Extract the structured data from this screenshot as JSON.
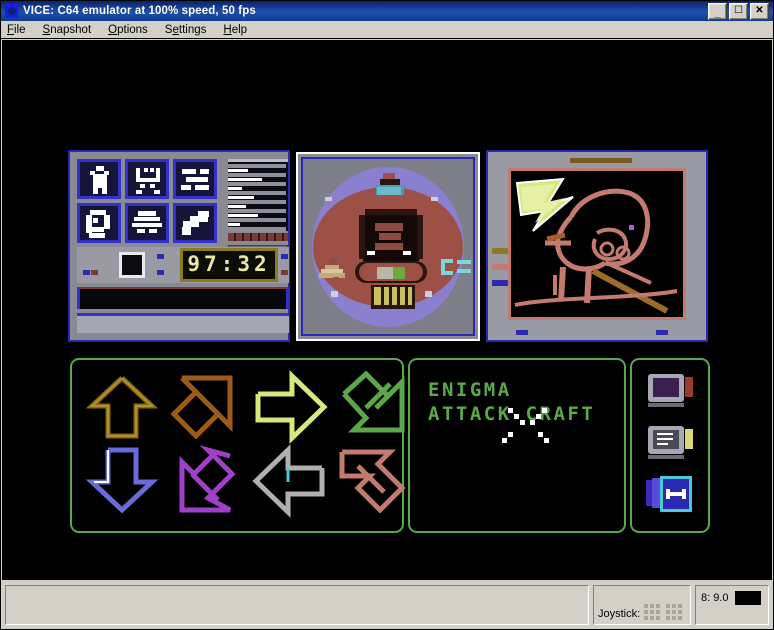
{
  "window": {
    "title": "VICE: C64 emulator at 100% speed, 50 fps",
    "icon": "vice-c64-icon",
    "buttons": {
      "minimize": "_",
      "maximize": "☐",
      "close": "✕"
    }
  },
  "menubar": {
    "items": [
      {
        "label": "File",
        "accel": "F"
      },
      {
        "label": "Snapshot",
        "accel": "S"
      },
      {
        "label": "Options",
        "accel": "O"
      },
      {
        "label": "Settings",
        "accel": "e"
      },
      {
        "label": "Help",
        "accel": "H"
      }
    ]
  },
  "emulator_screen": {
    "background": "#000000",
    "top_left_console": {
      "frame_color": "#2a2ab0",
      "body_color": "#8a8a94",
      "tiles": [
        {
          "name": "figure-icon",
          "row": 0,
          "col": 0
        },
        {
          "name": "invader-icon",
          "row": 0,
          "col": 1
        },
        {
          "name": "terrain-icon",
          "row": 0,
          "col": 2
        },
        {
          "name": "helmet-icon",
          "row": 1,
          "col": 0
        },
        {
          "name": "planet-icon",
          "row": 1,
          "col": 1
        },
        {
          "name": "bird-icon",
          "row": 1,
          "col": 2
        }
      ],
      "clock_display": "97:32",
      "clock_color": "#e8e8a0",
      "data_strips": 8,
      "progress_bars": [
        {
          "name": "bar-grey",
          "color": "#6f6f7c"
        },
        {
          "name": "bar-blue",
          "color": "#2a2ab0"
        }
      ]
    },
    "center_viewport": {
      "shape": "circle",
      "outer_color": "#8b7fd0",
      "inner_color": "#9c5046",
      "subject": "attack-craft-front-view",
      "side_marking": "E="
    },
    "right_viewport": {
      "subject": "creature-line-art",
      "bezel_color": "#c47a6e",
      "highlight": "lightning-bolt",
      "highlight_color": "#d8e87a"
    },
    "direction_pad": {
      "border_color": "#5aa84a",
      "arrows": [
        {
          "name": "arrow-north",
          "color": "#8a6a10",
          "dir": "N"
        },
        {
          "name": "arrow-northeast",
          "color": "#a05a18",
          "dir": "NE"
        },
        {
          "name": "arrow-east",
          "color": "#d8e87a",
          "dir": "E"
        },
        {
          "name": "arrow-southeast",
          "color": "#5aa84a",
          "dir": "SE"
        },
        {
          "name": "arrow-south",
          "color": "#6a6ad8",
          "dir": "S"
        },
        {
          "name": "arrow-southwest",
          "color": "#a040c8",
          "dir": "SW"
        },
        {
          "name": "arrow-west",
          "color": "#b0b0b0",
          "dir": "W"
        },
        {
          "name": "arrow-northwest",
          "color": "#c47a6e",
          "dir": "NW"
        }
      ]
    },
    "title_panel": {
      "line1": "ENIGMA",
      "line2": "ATTACK CRAFT",
      "text_color": "#5aa84a",
      "border_color": "#5aa84a"
    },
    "mode_icons": {
      "border_color": "#5aa84a",
      "items": [
        {
          "name": "monitor-purple-icon",
          "screen": "#3a2050",
          "tab": "#9c3a30",
          "selected": false
        },
        {
          "name": "monitor-text-icon",
          "screen": "#4a4a58",
          "tab": "#d8d87a",
          "selected": false
        },
        {
          "name": "transfer-icon",
          "screen": "#2a2ab0",
          "tab": "#4ac8d8",
          "selected": true
        }
      ]
    }
  },
  "statusbar": {
    "message": "",
    "joystick_label": "Joystick:",
    "joystick_ports": 2,
    "drive_label": "8: 9.0",
    "drive_led_color": "#000000"
  }
}
